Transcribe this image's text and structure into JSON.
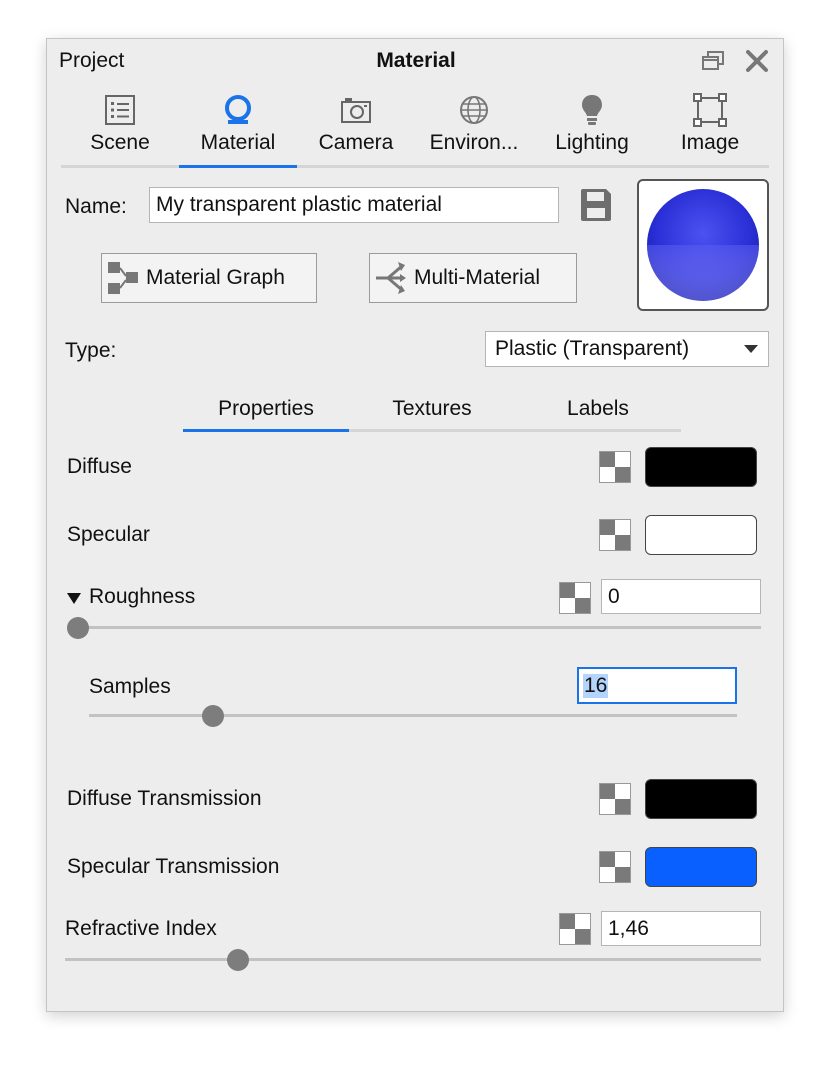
{
  "window": {
    "left_title": "Project",
    "title": "Material",
    "icons": [
      "restore-icon",
      "close-icon"
    ]
  },
  "tabs": [
    {
      "label": "Scene",
      "icon": "list-icon"
    },
    {
      "label": "Material",
      "icon": "material-icon",
      "active": true
    },
    {
      "label": "Camera",
      "icon": "camera-icon"
    },
    {
      "label": "Environ...",
      "icon": "globe-icon"
    },
    {
      "label": "Lighting",
      "icon": "bulb-icon"
    },
    {
      "label": "Image",
      "icon": "image-frame-icon"
    }
  ],
  "name_label": "Name:",
  "name_value": "My transparent plastic material",
  "buttons": {
    "material_graph": "Material Graph",
    "multi_material": "Multi-Material"
  },
  "type_label": "Type:",
  "type_value": "Plastic (Transparent)",
  "subtabs": [
    {
      "label": "Properties",
      "active": true
    },
    {
      "label": "Textures"
    },
    {
      "label": "Labels"
    }
  ],
  "properties": {
    "diffuse": {
      "label": "Diffuse",
      "color": "#000000"
    },
    "specular": {
      "label": "Specular",
      "color": "#ffffff"
    },
    "roughness": {
      "label": "Roughness",
      "value": "0",
      "slider_fraction": 0.0
    },
    "samples": {
      "label": "Samples",
      "value": "16",
      "slider_fraction": 0.18
    },
    "diffuse_transmission": {
      "label": "Diffuse Transmission",
      "color": "#000000"
    },
    "specular_transmission": {
      "label": "Specular Transmission",
      "color": "#0a60ff"
    },
    "refractive_index": {
      "label": "Refractive Index",
      "value": "1,46",
      "slider_fraction": 0.24
    }
  },
  "colors": {
    "accent": "#1a73e8",
    "selection": "#b3d4fc"
  }
}
